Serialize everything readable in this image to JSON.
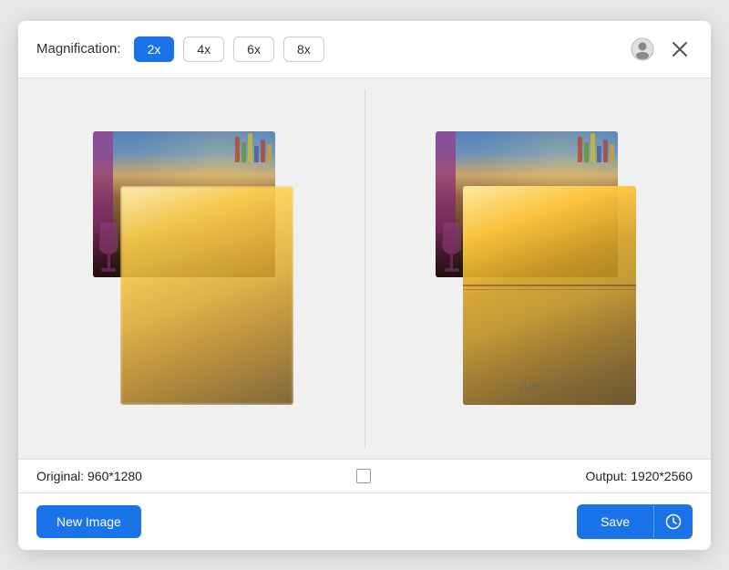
{
  "header": {
    "magnification_label": "Magnification:",
    "buttons": [
      {
        "label": "2x",
        "active": true
      },
      {
        "label": "4x",
        "active": false
      },
      {
        "label": "6x",
        "active": false
      },
      {
        "label": "8x",
        "active": false
      }
    ]
  },
  "preview": {
    "original_label": "Original: 960*1280",
    "output_label": "Output: 1920*2560",
    "after_label": "After"
  },
  "footer": {
    "new_image_label": "New Image",
    "save_label": "Save"
  }
}
